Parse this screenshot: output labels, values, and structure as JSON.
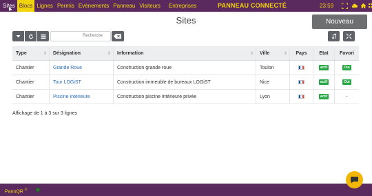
{
  "topnav": {
    "items": [
      {
        "label": "Sites"
      },
      {
        "label": "Blocs"
      },
      {
        "label": "Lignes"
      },
      {
        "label": "Permis"
      },
      {
        "label": "Evènements"
      },
      {
        "label": "Panneau"
      },
      {
        "label": "Visiteurs"
      },
      {
        "label": "Entreprises"
      }
    ],
    "brand": "PANNEAU CONNECTÉ",
    "time": "23:59",
    "icons": [
      "fullscreen-icon",
      "cloud-icon",
      "home-icon",
      "apps-icon"
    ]
  },
  "page": {
    "title": "Sites",
    "new_button": "Nouveau"
  },
  "toolbar": {
    "search_placeholder": "Recherche"
  },
  "table": {
    "columns": [
      "Type",
      "Désignation",
      "Information",
      "Ville",
      "Pays",
      "Etat",
      "Favori"
    ],
    "rows": [
      {
        "type": "Chantier",
        "designation": "Grande Roue",
        "information": "Construction grande roue",
        "ville": "Toulon",
        "etat": "actif",
        "favori": "Oui"
      },
      {
        "type": "Chantier",
        "designation": "Tour LOGiST",
        "information": "Construction immeuble de bureaux LOGiST",
        "ville": "Nice",
        "etat": "actif",
        "favori": "Oui"
      },
      {
        "type": "Chantier",
        "designation": "Piscine intérieure",
        "information": "Construction piscine intérieure privée",
        "ville": "Lyon",
        "etat": "actif",
        "favori": "-"
      }
    ]
  },
  "footer": {
    "info": "Affichage de 1 à 3 sur 3 lignes",
    "app_name": "PanoQR",
    "app_mark": "©"
  },
  "colors": {
    "brand_purple": "#5a2a5e",
    "accent_yellow": "#f5d20a",
    "badge_green": "#28a745"
  }
}
